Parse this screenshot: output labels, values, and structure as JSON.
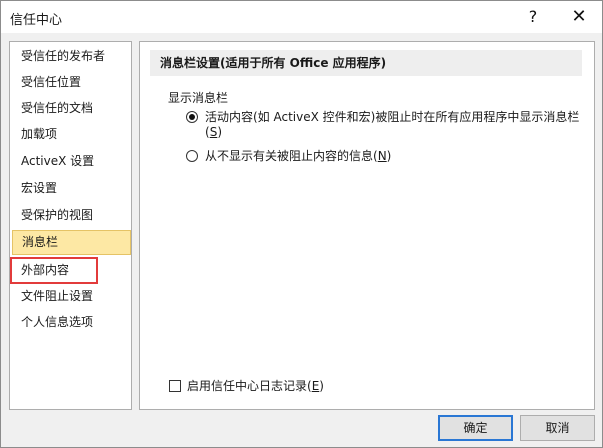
{
  "window": {
    "title": "信任中心",
    "help_glyph": "?",
    "close_glyph": "✕"
  },
  "sidebar": {
    "items": [
      {
        "label": "受信任的发布者"
      },
      {
        "label": "受信任位置"
      },
      {
        "label": "受信任的文档"
      },
      {
        "label": "加载项"
      },
      {
        "label": "ActiveX 设置"
      },
      {
        "label": "宏设置"
      },
      {
        "label": "受保护的视图"
      },
      {
        "label": "消息栏",
        "selected": true
      },
      {
        "label": "外部内容",
        "highlighted": true
      },
      {
        "label": "文件阻止设置"
      },
      {
        "label": "个人信息选项"
      }
    ]
  },
  "content": {
    "section_title": "消息栏设置(适用于所有 Office 应用程序)",
    "group_label": "显示消息栏",
    "option1": {
      "line1": "活动内容(如 ActiveX 控件和宏)被阻止时在所有应用程序中显示消息栏",
      "line2_pre": "(",
      "hotkey": "S",
      "line2_post": ")",
      "checked": true
    },
    "option2": {
      "text_pre": "从不显示有关被阻止内容的信息(",
      "hotkey": "N",
      "text_post": ")",
      "checked": false
    },
    "log_checkbox": {
      "text_pre": "启用信任中心日志记录(",
      "hotkey": "E",
      "text_post": ")",
      "checked": false
    }
  },
  "buttons": {
    "ok": "确定",
    "cancel": "取消"
  },
  "colors": {
    "selected_bg": "#fde8a4",
    "highlight_border": "#e23b3b",
    "default_button_border": "#2a77d4"
  }
}
